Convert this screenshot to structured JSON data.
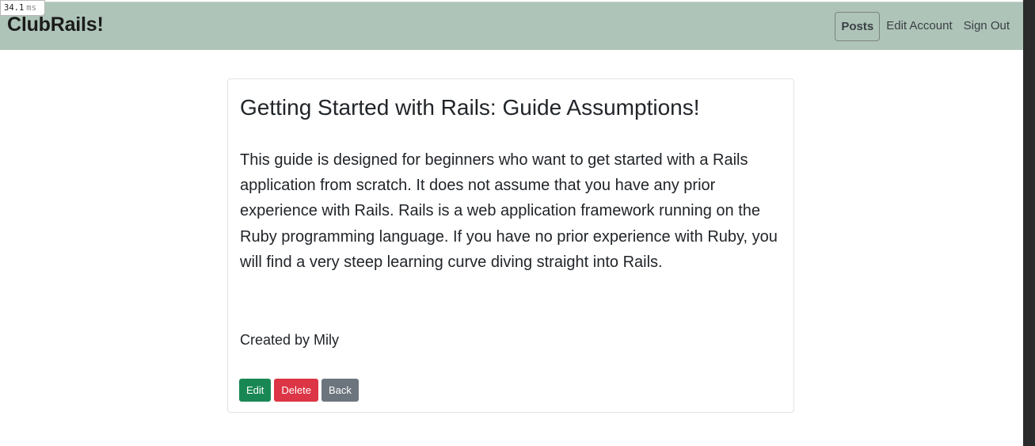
{
  "debug": {
    "timing_value": "34.1",
    "timing_unit": "ms"
  },
  "navbar": {
    "brand": "ClubRails!",
    "links": [
      {
        "label": "Posts",
        "active": true
      },
      {
        "label": "Edit Account",
        "active": false
      },
      {
        "label": "Sign Out",
        "active": false
      }
    ],
    "background": "#aec4b8"
  },
  "post": {
    "title": "Getting Started with Rails: Guide Assumptions!",
    "body": "This guide is designed for beginners who want to get started with a Rails application from scratch. It does not assume that you have any prior experience with Rails. Rails is a web application framework running on the Ruby programming language. If you have no prior experience with Ruby, you will find a very steep learning curve diving straight into Rails.",
    "author_line": "Created by Mily"
  },
  "actions": {
    "edit_label": "Edit",
    "delete_label": "Delete",
    "back_label": "Back",
    "colors": {
      "edit": "#198754",
      "delete": "#dc3545",
      "back": "#6c757d"
    }
  }
}
